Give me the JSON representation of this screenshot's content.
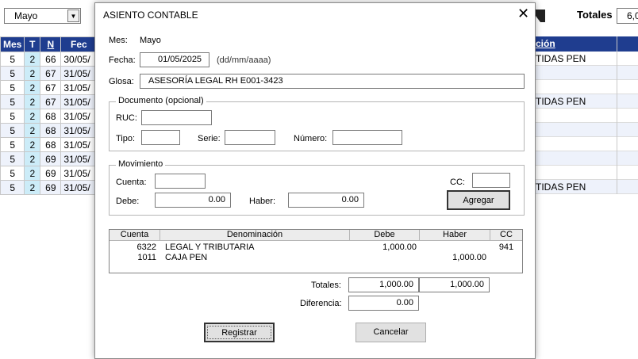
{
  "background": {
    "month_selector": {
      "value": "Mayo"
    },
    "totals": {
      "label": "Totales",
      "value": "6,0"
    },
    "columns": [
      "Mes",
      "T",
      "N",
      "Fec"
    ],
    "right_header": "ción",
    "rows": [
      {
        "mes": "5",
        "t": "2",
        "n": "66",
        "fecha": "30/05/",
        "desc": "TIDAS PEN"
      },
      {
        "mes": "5",
        "t": "2",
        "n": "67",
        "fecha": "31/05/",
        "desc": ""
      },
      {
        "mes": "5",
        "t": "2",
        "n": "67",
        "fecha": "31/05/",
        "desc": ""
      },
      {
        "mes": "5",
        "t": "2",
        "n": "67",
        "fecha": "31/05/",
        "desc": "TIDAS PEN"
      },
      {
        "mes": "5",
        "t": "2",
        "n": "68",
        "fecha": "31/05/",
        "desc": ""
      },
      {
        "mes": "5",
        "t": "2",
        "n": "68",
        "fecha": "31/05/",
        "desc": ""
      },
      {
        "mes": "5",
        "t": "2",
        "n": "68",
        "fecha": "31/05/",
        "desc": ""
      },
      {
        "mes": "5",
        "t": "2",
        "n": "69",
        "fecha": "31/05/",
        "desc": ""
      },
      {
        "mes": "5",
        "t": "2",
        "n": "69",
        "fecha": "31/05/",
        "desc": ""
      },
      {
        "mes": "5",
        "t": "2",
        "n": "69",
        "fecha": "31/05/",
        "desc": "TIDAS PEN"
      }
    ]
  },
  "dialog": {
    "title": "ASIENTO CONTABLE",
    "mes": {
      "label": "Mes:",
      "value": "Mayo"
    },
    "fecha": {
      "label": "Fecha:",
      "value": "01/05/2025",
      "hint": "(dd/mm/aaaa)"
    },
    "glosa": {
      "label": "Glosa:",
      "value": "ASESORÍA LEGAL RH E001-3423"
    },
    "documento": {
      "legend": "Documento (opcional)",
      "ruc_label": "RUC:",
      "ruc_value": "",
      "tipo_label": "Tipo:",
      "tipo_value": "",
      "serie_label": "Serie:",
      "serie_value": "",
      "numero_label": "Número:",
      "numero_value": ""
    },
    "movimiento": {
      "legend": "Movimiento",
      "cuenta_label": "Cuenta:",
      "cuenta_value": "",
      "cc_label": "CC:",
      "cc_value": "",
      "debe_label": "Debe:",
      "debe_value": "0.00",
      "haber_label": "Haber:",
      "haber_value": "0.00",
      "agregar_label": "Agregar"
    },
    "grid": {
      "headers": [
        "Cuenta",
        "Denominación",
        "Debe",
        "Haber",
        "CC"
      ],
      "rows": [
        {
          "cuenta": "6322",
          "denominacion": "LEGAL Y TRIBUTARIA",
          "debe": "1,000.00",
          "haber": "",
          "cc": "941"
        },
        {
          "cuenta": "1011",
          "denominacion": "CAJA PEN",
          "debe": "",
          "haber": "1,000.00",
          "cc": ""
        }
      ]
    },
    "totales": {
      "label": "Totales:",
      "debe": "1,000.00",
      "haber": "1,000.00"
    },
    "diferencia": {
      "label": "Diferencia:",
      "value": "0.00"
    },
    "registrar_label": "Registrar",
    "cancelar_label": "Cancelar",
    "close_icon": "close-icon"
  }
}
